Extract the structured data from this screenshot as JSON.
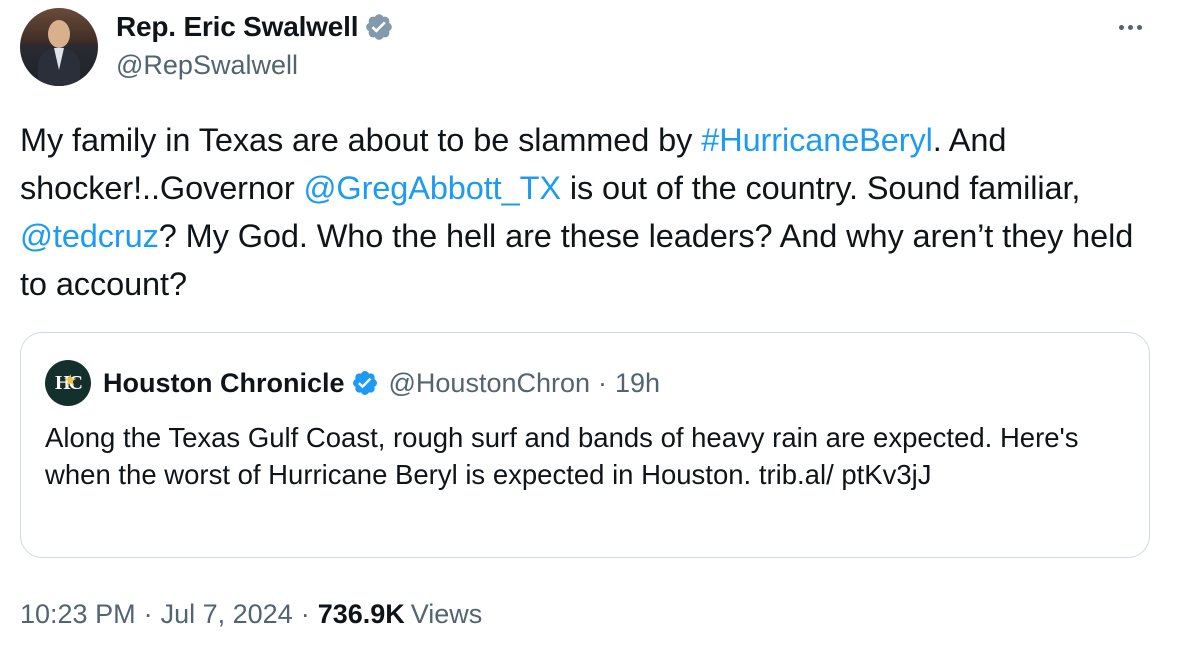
{
  "author": {
    "display_name": "Rep. Eric Swalwell",
    "handle": "@RepSwalwell",
    "verified_color": "#829aab"
  },
  "tweet": {
    "segments": [
      {
        "text": "My family in Texas are about to be slammed by ",
        "type": "text"
      },
      {
        "text": "#HurricaneBeryl",
        "type": "hashtag"
      },
      {
        "text": ". And shocker!..Governor ",
        "type": "text"
      },
      {
        "text": "@GregAbbott_TX",
        "type": "mention"
      },
      {
        "text": " is out of the country. Sound familiar, ",
        "type": "text"
      },
      {
        "text": "@tedcruz",
        "type": "mention"
      },
      {
        "text": "? My God. Who the hell are these leaders? And why aren’t they held to account?",
        "type": "text"
      }
    ]
  },
  "quote": {
    "logo_text": "HC",
    "name": "Houston Chronicle",
    "handle": "@HoustonChron",
    "separator": "·",
    "time": "19h",
    "text": "Along the Texas Gulf Coast, rough surf and bands of heavy rain are expected. Here's when the worst of Hurricane Beryl is expected in Houston. trib.al/ ptKv3jJ",
    "verified_color": "#1d9bf0"
  },
  "meta": {
    "time": "10:23 PM",
    "sep1": "·",
    "date": "Jul 7, 2024",
    "sep2": "·",
    "views_count": "736.9K",
    "views_label": "Views"
  },
  "colors": {
    "link": "#1d9bf0",
    "secondary_text": "#536471",
    "primary_text": "#0f1419",
    "border": "#cfd9de"
  },
  "icons": {
    "author_badge": "verified-badge-icon",
    "quote_badge": "verified-badge-icon",
    "more": "more-options-icon"
  }
}
